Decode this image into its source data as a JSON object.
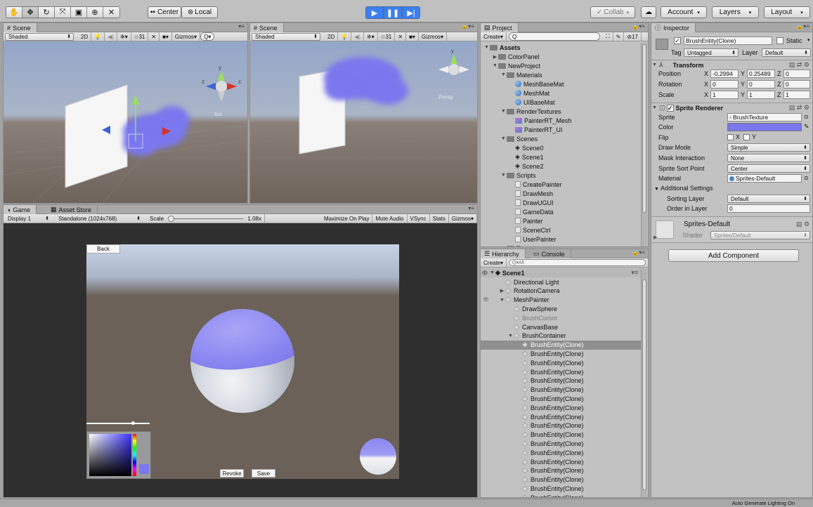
{
  "toolbar": {
    "pivot": "Center",
    "space": "Local",
    "collab": "Collab",
    "account": "Account",
    "layers": "Layers",
    "layout": "Layout"
  },
  "scene_left": {
    "tab": "Scene",
    "shading": "Shaded",
    "mode_2d": "2D",
    "gizmo_count": "31",
    "gizmos": "Gizmos",
    "view_label": "Iso"
  },
  "scene_right": {
    "tab": "Scene",
    "shading": "Shaded",
    "mode_2d": "2D",
    "gizmo_count": "31",
    "gizmos": "Gizmos",
    "view_label": "Persp"
  },
  "game": {
    "tab_game": "Game",
    "tab_asset": "Asset Store",
    "display": "Display 1",
    "resolution": "Standalone (1024x768)",
    "scale_label": "Scale",
    "scale_value": "1.08x",
    "maximize": "Maximize On Play",
    "mute": "Mute Audio",
    "vsync": "VSync",
    "stats": "Stats",
    "gizmos": "Gizmos",
    "back": "Back",
    "revoke": "Revoke",
    "save": "Save",
    "slider_value": 0.75
  },
  "project": {
    "tab": "Project",
    "create": "Create",
    "count": "17",
    "items": [
      {
        "label": "Assets",
        "depth": 0,
        "type": "folder",
        "bold": true,
        "open": true
      },
      {
        "label": "ColorPanel",
        "depth": 1,
        "type": "folder",
        "open": false
      },
      {
        "label": "NewProject",
        "depth": 1,
        "type": "folder",
        "open": true
      },
      {
        "label": "Materials",
        "depth": 2,
        "type": "folder",
        "open": true
      },
      {
        "label": "MeshBaseMat",
        "depth": 3,
        "type": "material"
      },
      {
        "label": "MeshMat",
        "depth": 3,
        "type": "material"
      },
      {
        "label": "UIBaseMat",
        "depth": 3,
        "type": "material"
      },
      {
        "label": "RenderTextures",
        "depth": 2,
        "type": "folder",
        "open": true
      },
      {
        "label": "PainterRT_Mesh",
        "depth": 3,
        "type": "rt"
      },
      {
        "label": "PainterRT_UI",
        "depth": 3,
        "type": "rt"
      },
      {
        "label": "Scenes",
        "depth": 2,
        "type": "folder",
        "open": true
      },
      {
        "label": "Scene0",
        "depth": 3,
        "type": "scene"
      },
      {
        "label": "Scene1",
        "depth": 3,
        "type": "scene"
      },
      {
        "label": "Scene2",
        "depth": 3,
        "type": "scene"
      },
      {
        "label": "Scripts",
        "depth": 2,
        "type": "folder",
        "open": true
      },
      {
        "label": "CreatePainter",
        "depth": 3,
        "type": "script"
      },
      {
        "label": "DrawMesh",
        "depth": 3,
        "type": "script"
      },
      {
        "label": "DrawUGUI",
        "depth": 3,
        "type": "script"
      },
      {
        "label": "GameData",
        "depth": 3,
        "type": "script"
      },
      {
        "label": "Painter",
        "depth": 3,
        "type": "script"
      },
      {
        "label": "SceneCtrl",
        "depth": 3,
        "type": "script"
      },
      {
        "label": "UserPainter",
        "depth": 3,
        "type": "script"
      },
      {
        "label": "Textures",
        "depth": 2,
        "type": "folder",
        "open": true
      }
    ]
  },
  "hierarchy": {
    "tab": "Hierarchy",
    "tab2": "Console",
    "create": "Create",
    "search_placeholder": "Q▾All",
    "scene": "Scene1",
    "items": [
      {
        "label": "Directional Light",
        "depth": 1
      },
      {
        "label": "RotationCamera",
        "depth": 1,
        "arrow": "closed"
      },
      {
        "label": "MeshPainter",
        "depth": 1,
        "arrow": "open"
      },
      {
        "label": "DrawSphere",
        "depth": 2
      },
      {
        "label": "BrushCursor",
        "depth": 2,
        "dim": true
      },
      {
        "label": "CanvasBase",
        "depth": 2
      },
      {
        "label": "BrushContainer",
        "depth": 2,
        "arrow": "open"
      },
      {
        "label": "BrushEntity(Clone)",
        "depth": 3,
        "selected": true
      },
      {
        "label": "BrushEntity(Clone)",
        "depth": 3
      },
      {
        "label": "BrushEntity(Clone)",
        "depth": 3
      },
      {
        "label": "BrushEntity(Clone)",
        "depth": 3
      },
      {
        "label": "BrushEntity(Clone)",
        "depth": 3
      },
      {
        "label": "BrushEntity(Clone)",
        "depth": 3
      },
      {
        "label": "BrushEntity(Clone)",
        "depth": 3
      },
      {
        "label": "BrushEntity(Clone)",
        "depth": 3
      },
      {
        "label": "BrushEntity(Clone)",
        "depth": 3
      },
      {
        "label": "BrushEntity(Clone)",
        "depth": 3
      },
      {
        "label": "BrushEntity(Clone)",
        "depth": 3
      },
      {
        "label": "BrushEntity(Clone)",
        "depth": 3
      },
      {
        "label": "BrushEntity(Clone)",
        "depth": 3
      },
      {
        "label": "BrushEntity(Clone)",
        "depth": 3
      },
      {
        "label": "BrushEntity(Clone)",
        "depth": 3
      },
      {
        "label": "BrushEntity(Clone)",
        "depth": 3
      },
      {
        "label": "BrushEntity(Clone)",
        "depth": 3
      },
      {
        "label": "BrushEntity(Clone)",
        "depth": 3
      },
      {
        "label": "BrushEntity(Clone)",
        "depth": 3
      },
      {
        "label": "BrushEntity(Clone)",
        "depth": 3
      },
      {
        "label": "BrushEntity(Clone)",
        "depth": 3
      }
    ]
  },
  "inspector": {
    "tab": "Inspector",
    "object_name": "BrushEntity(Clone)",
    "static": "Static",
    "tag_label": "Tag",
    "tag": "Untagged",
    "layer_label": "Layer",
    "layer": "Default",
    "transform": {
      "title": "Transform",
      "position_label": "Position",
      "rotation_label": "Rotation",
      "scale_label": "Scale",
      "px": "-0.2994",
      "py": "0.25489",
      "pz": "0",
      "rx": "0",
      "ry": "0",
      "rz": "0",
      "sx": "1",
      "sy": "1",
      "sz": "1"
    },
    "sprite_renderer": {
      "title": "Sprite Renderer",
      "sprite_label": "Sprite",
      "sprite": "BrushTexture",
      "color_label": "Color",
      "color": "#7b77ee",
      "flip_label": "Flip",
      "flip_x": "X",
      "flip_y": "Y",
      "draw_mode_label": "Draw Mode",
      "draw_mode": "Simple",
      "mask_label": "Mask Interaction",
      "mask": "None",
      "sort_point_label": "Sprite Sort Point",
      "sort_point": "Center",
      "material_label": "Material",
      "material": "Sprites-Default",
      "additional": "Additional Settings",
      "sorting_layer_label": "Sorting Layer",
      "sorting_layer": "Default",
      "order_label": "Order in Layer",
      "order": "0"
    },
    "material_name": "Sprites-Default",
    "shader_label": "Shader",
    "shader": "Sprites/Default",
    "add_component": "Add Component"
  },
  "status": {
    "text": "Auto Generate Lighting On"
  },
  "colors": {
    "accent": "#3d7ff0",
    "brush": "#7b77ee",
    "selection": "#8f8f8f"
  }
}
